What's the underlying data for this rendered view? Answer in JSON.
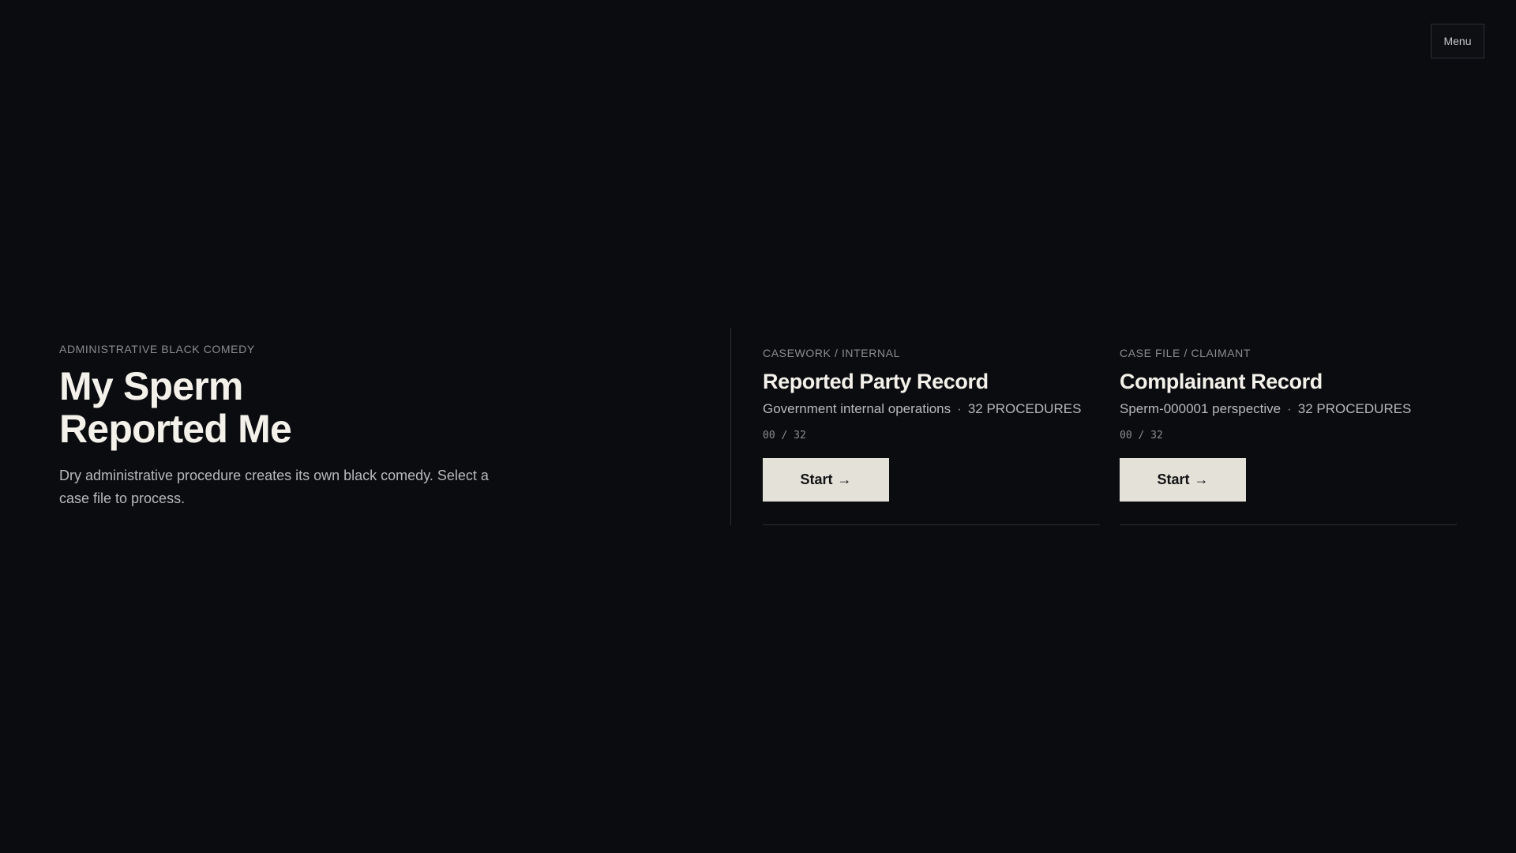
{
  "header": {
    "menu_label": "Menu"
  },
  "hero": {
    "eyebrow": "ADMINISTRATIVE BLACK COMEDY",
    "title_line_1": "My Sperm",
    "title_line_2": "Reported Me",
    "subtitle": "Dry administrative procedure creates its own black comedy. Select a case file to process."
  },
  "cases": [
    {
      "kicker": "CASEWORK / INTERNAL",
      "title": "Reported Party Record",
      "description": "Government internal operations",
      "procedures": "32 PROCEDURES",
      "progress": "00 / 32",
      "button_label": "Start",
      "button_icon": "arrow-right-icon"
    },
    {
      "kicker": "CASE FILE / CLAIMANT",
      "title": "Complainant Record",
      "description": "Sperm-000001 perspective",
      "procedures": "32 PROCEDURES",
      "progress": "00 / 32",
      "button_label": "Start",
      "button_icon": "arrow-right-icon"
    }
  ],
  "colors": {
    "background": "#0a0c0f",
    "button": "#e4e1d8",
    "muted_text": "#8b8d90"
  }
}
